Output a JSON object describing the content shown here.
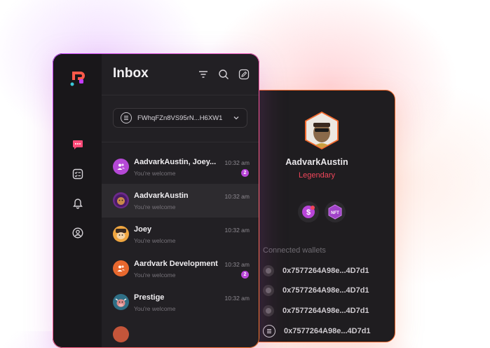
{
  "inbox": {
    "title": "Inbox",
    "wallet_selector": "FWhqFZn8VS95rN...H6XW1",
    "conversations": [
      {
        "name": "AadvarkAustin, Joey...",
        "preview": "You're welcome",
        "time": "10:32 am",
        "unread": "2",
        "avatar": "group-icon",
        "color": "#b548d6"
      },
      {
        "name": "AadvarkAustin",
        "preview": "You're welcome",
        "time": "10:32 am",
        "unread": "",
        "avatar": "lion-avatar",
        "color": "#6b2a8a"
      },
      {
        "name": "Joey",
        "preview": "You're welcome",
        "time": "10:32 am",
        "unread": "",
        "avatar": "monkey-avatar",
        "color": "#f0a640"
      },
      {
        "name": "Aardvark Development",
        "preview": "You're welcome",
        "time": "10:32 am",
        "unread": "2",
        "avatar": "group-icon",
        "color": "#e8682e"
      },
      {
        "name": "Prestige",
        "preview": "You're welcome",
        "time": "10:32 am",
        "unread": "",
        "avatar": "bull-avatar",
        "color": "#2f6f86"
      }
    ]
  },
  "profile": {
    "name": "AadvarkAustin",
    "rank": "Legendary",
    "badges": [
      "dollar-badge-icon",
      "nft-badge-icon"
    ],
    "wallets_title": "Connected wallets",
    "wallets": [
      "0x7577264A98e...4D7d1",
      "0x7577264A98e...4D7d1",
      "0x7577264A98e...4D7d1",
      "0x7577264A98e...4D7d1"
    ]
  },
  "colors": {
    "accent_purple": "#b845d8",
    "accent_red": "#f0465a",
    "border_orange": "#f26a2e",
    "panel_bg": "#222024"
  }
}
